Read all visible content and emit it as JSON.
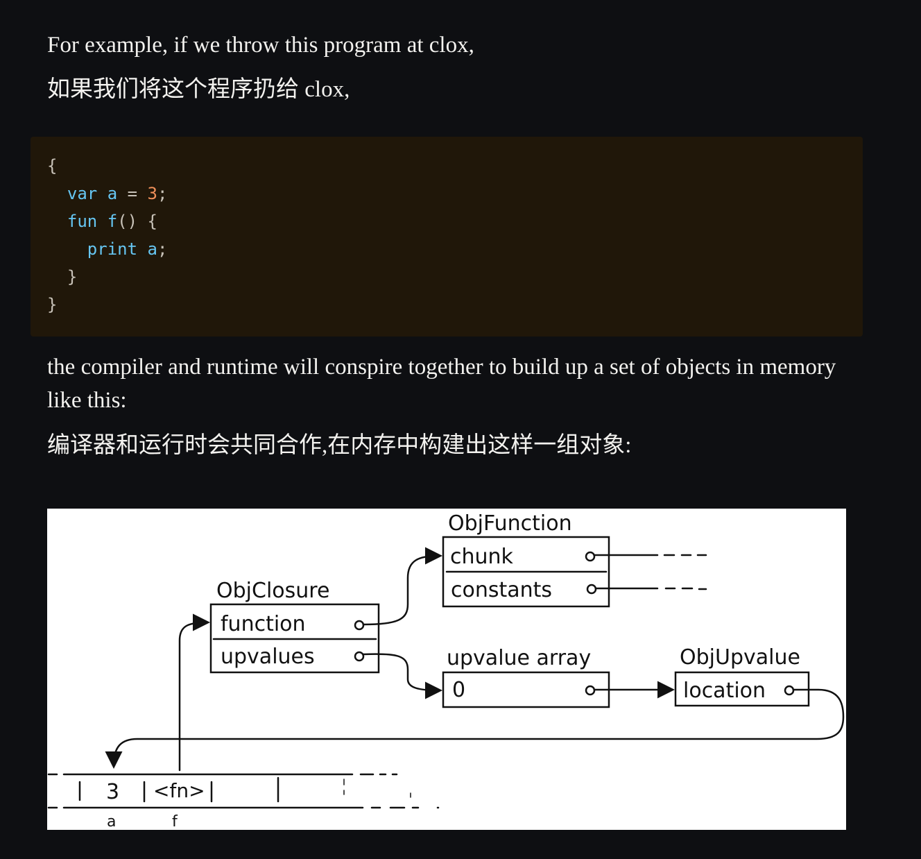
{
  "paragraphs": {
    "intro_en": "For example, if we throw this program at clox,",
    "intro_zh": "如果我们将这个程序扔给 clox,",
    "result_en": "the compiler and runtime will conspire together to build up a set of objects in memory like this:",
    "result_zh": "编译器和运行时会共同合作,在内存中构建出这样一组对象:"
  },
  "code": {
    "line1": "{",
    "line2_kw": "var",
    "line2_name": "a",
    "line2_op": "=",
    "line2_num": "3",
    "line2_end": ";",
    "line3_kw": "fun",
    "line3_name": "f",
    "line3_rest": "() {",
    "line4_kw": "print",
    "line4_name": "a",
    "line4_end": ";",
    "line5": "}",
    "line6": "}"
  },
  "diagram": {
    "objfunction_title": "ObjFunction",
    "objfunction_field1": "chunk",
    "objfunction_field2": "constants",
    "objclosure_title": "ObjClosure",
    "objclosure_field1": "function",
    "objclosure_field2": "upvalues",
    "upvalue_array_title": "upvalue array",
    "upvalue_array_slot": "0",
    "objupvalue_title": "ObjUpvalue",
    "objupvalue_field": "location",
    "stack_value_a": "3",
    "stack_value_f": "<fn>",
    "stack_label_a": "a",
    "stack_label_f": "f"
  }
}
